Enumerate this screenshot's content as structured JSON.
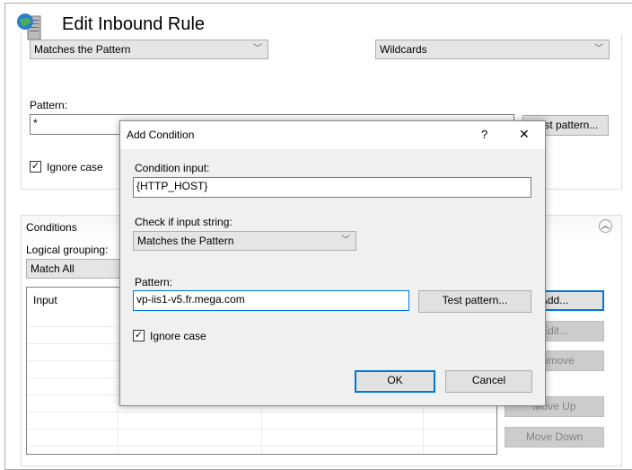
{
  "window": {
    "title": "Edit Inbound Rule",
    "icon": "iis-server-globe-icon"
  },
  "rule": {
    "requested_url": "Matches the Pattern",
    "using": "Wildcards",
    "pattern_label": "Pattern:",
    "pattern_value": "*",
    "test_pattern": "Test pattern...",
    "ignore_case": "Ignore case",
    "ignore_case_checked": true
  },
  "conditions": {
    "header": "Conditions",
    "logical_grouping_label": "Logical grouping:",
    "logical_grouping": "Match All",
    "columns": [
      "Input",
      "",
      "",
      ""
    ],
    "buttons": {
      "add": "Add...",
      "edit": "Edit...",
      "remove": "Remove",
      "move_up": "Move Up",
      "move_down": "Move Down"
    }
  },
  "dialog": {
    "title": "Add Condition",
    "help": "?",
    "close": "✕",
    "condition_input_label": "Condition input:",
    "condition_input": "{HTTP_HOST}",
    "check_label": "Check if input string:",
    "check_value": "Matches the Pattern",
    "pattern_label": "Pattern:",
    "pattern_value": "vp-iis1-v5.fr.mega.com",
    "test_pattern": "Test pattern...",
    "ignore_case": "Ignore case",
    "ignore_case_checked": true,
    "ok": "OK",
    "cancel": "Cancel"
  },
  "colors": {
    "accent": "#0078d7",
    "dialog_bg": "#f0f0f0"
  }
}
